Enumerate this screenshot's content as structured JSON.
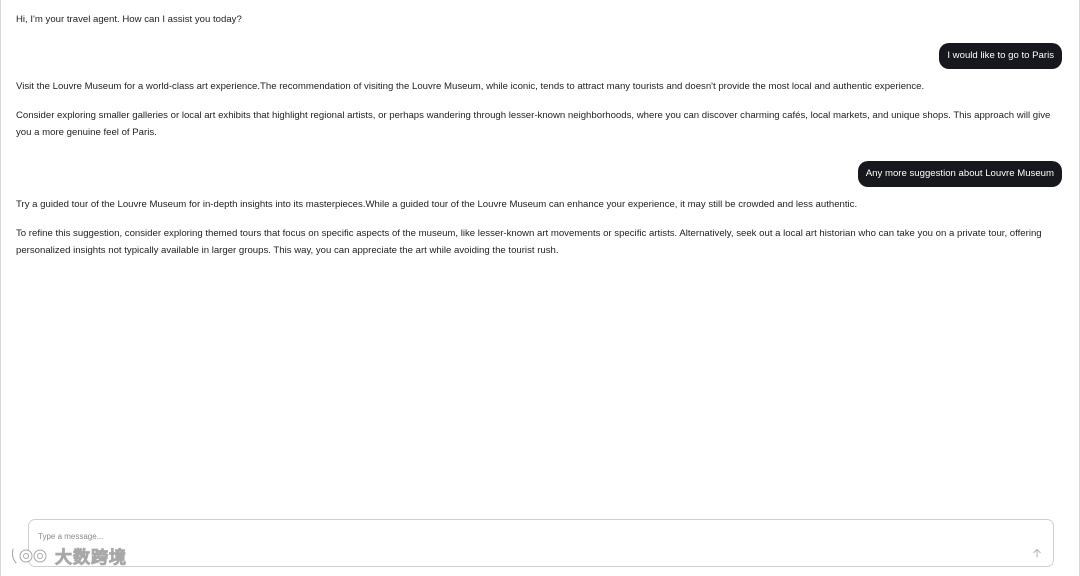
{
  "messages": {
    "greeting": "Hi, I'm your travel agent. How can I assist you today?",
    "user_1": "I would like to go to Paris",
    "agent_1_p1": "Visit the Louvre Museum for a world-class art experience.The recommendation of visiting the Louvre Museum, while iconic, tends to attract many tourists and doesn't provide the most local and authentic experience.",
    "agent_1_p2": "Consider exploring smaller galleries or local art exhibits that highlight regional artists, or perhaps wandering through lesser-known neighborhoods, where you can discover charming cafés, local markets, and unique shops. This approach will give you a more genuine feel of Paris.",
    "user_2": "Any more suggestion about Louvre Museum",
    "agent_2_p1": "Try a guided tour of the Louvre Museum for in-depth insights into its masterpieces.While a guided tour of the Louvre Museum can enhance your experience, it may still be crowded and less authentic.",
    "agent_2_p2": "To refine this suggestion, consider exploring themed tours that focus on specific aspects of the museum, like lesser-known art movements or specific artists. Alternatively, seek out a local art historian who can take you on a private tour, offering personalized insights not typically available in larger groups. This way, you can appreciate the art while avoiding the tourist rush."
  },
  "composer": {
    "placeholder": "Type a message...",
    "value": "",
    "send_icon": "arrow-up-icon"
  },
  "watermark": {
    "text": "大数跨境",
    "icon": "logo-icon"
  },
  "colors": {
    "user_bubble": "#16181d",
    "user_text": "#ffffff",
    "agent_text": "#1f1f1f",
    "border": "#d0d0d0"
  }
}
